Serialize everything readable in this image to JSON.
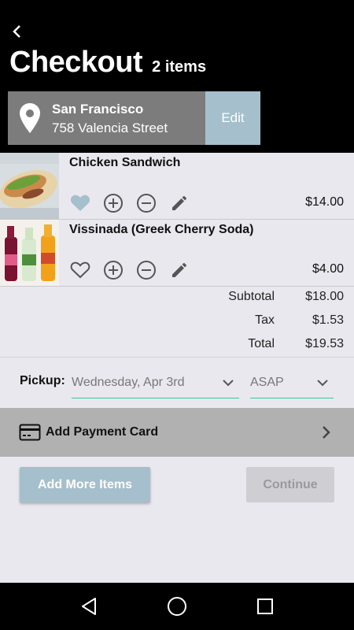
{
  "header": {
    "title": "Checkout",
    "item_count": "2 items"
  },
  "location": {
    "city": "San Francisco",
    "street": "758 Valencia Street",
    "edit_label": "Edit"
  },
  "items": [
    {
      "name": "Chicken Sandwich",
      "price": "$14.00",
      "favorited": true
    },
    {
      "name": "Vissinada (Greek Cherry Soda)",
      "price": "$4.00",
      "favorited": false
    }
  ],
  "totals": {
    "subtotal_label": "Subtotal",
    "subtotal": "$18.00",
    "tax_label": "Tax",
    "tax": "$1.53",
    "total_label": "Total",
    "total": "$19.53"
  },
  "pickup": {
    "label": "Pickup:",
    "date": "Wednesday, Apr 3rd",
    "time": "ASAP"
  },
  "payment": {
    "label": "Add Payment Card"
  },
  "actions": {
    "add_more_label": "Add More Items",
    "continue_label": "Continue"
  },
  "colors": {
    "accent": "#a5bfcc",
    "underline": "#37c59a",
    "header_bg": "#000000",
    "page_bg": "#e9e8ef"
  },
  "icons": [
    "back-icon",
    "location-pin-icon",
    "heart-icon",
    "plus-circle-icon",
    "minus-circle-icon",
    "pencil-icon",
    "chevron-down-icon",
    "credit-card-icon",
    "chevron-right-icon",
    "nav-back-icon",
    "nav-home-icon",
    "nav-recents-icon"
  ]
}
